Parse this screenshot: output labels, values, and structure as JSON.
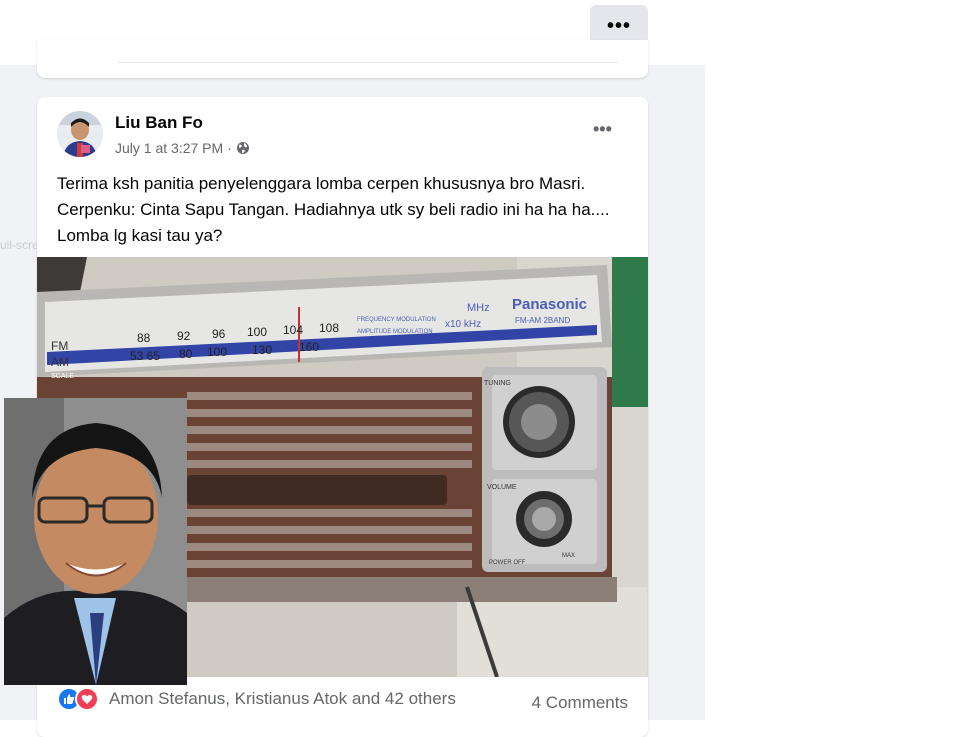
{
  "header": {
    "more_label": "•••"
  },
  "ghost_text": "ull-screen snip",
  "post": {
    "author": "Liu Ban Fo",
    "timestamp": "July 1 at 3:27 PM",
    "separator": "·",
    "privacy_icon": "globe-icon",
    "more_label": "•••",
    "text": "Terima ksh panitia penyelenggara lomba cerpen khususnya bro Masri. Cerpenku: Cinta Sapu Tangan. Hadiahnya utk sy beli radio ini ha ha ha.... Lomba lg kasi tau ya?",
    "photo": {
      "brand": "Panasonic",
      "band": "FM-AM 2BAND",
      "fm_label": "FM",
      "am_label": "AM",
      "scale_label": "SCALE",
      "mhz": "MHz",
      "khz": "x10 kHz",
      "freq_mod": "FREQUENCY MODULATION",
      "amp_mod": "AMPLITUDE MODULATION",
      "fm_ticks": [
        "88",
        "92",
        "96",
        "100",
        "104",
        "108"
      ],
      "am_ticks": [
        "53 65",
        "80",
        "100",
        "130",
        "160"
      ],
      "tuning": "TUNING",
      "volume": "VOLUME",
      "power_off": "POWER OFF",
      "max": "MAX"
    },
    "reactions": {
      "icons": [
        "like-icon",
        "love-icon"
      ],
      "names": "Amon Stefanus, Kristianus Atok and 42 others"
    },
    "comments": "4 Comments"
  },
  "colors": {
    "accent": "#1877f2",
    "love": "#f33e58",
    "feed_bg": "#f0f2f5",
    "secondary_text": "#65676b"
  }
}
